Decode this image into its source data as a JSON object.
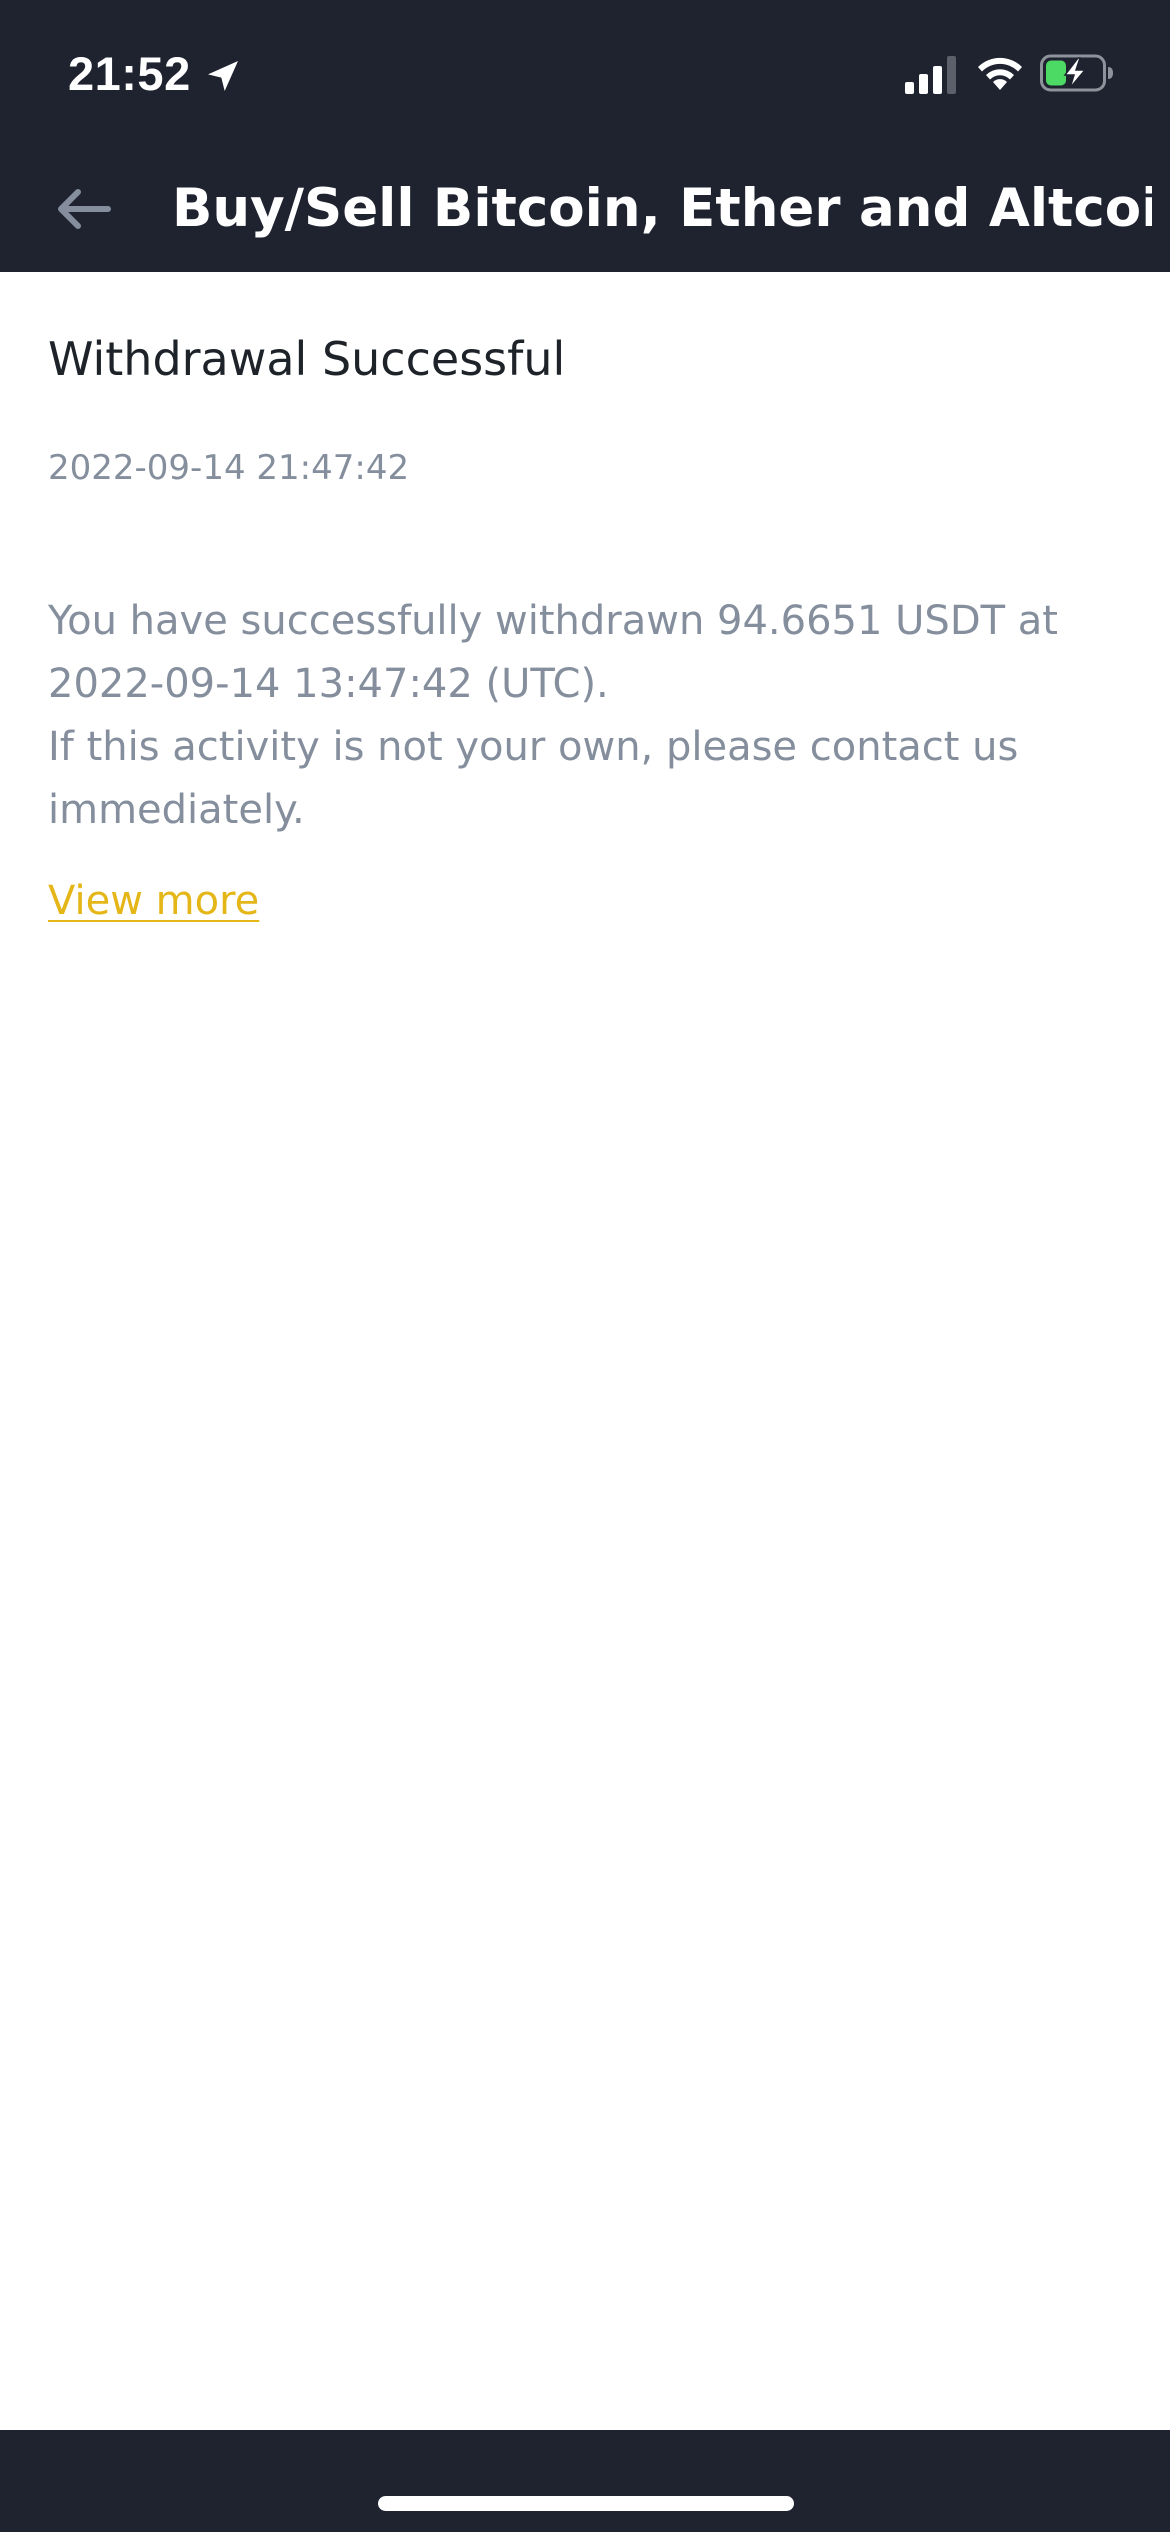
{
  "status_bar": {
    "time": "21:52",
    "icons": [
      "location-arrow-icon",
      "cellular-signal-icon",
      "wifi-icon",
      "battery-charging-icon"
    ]
  },
  "header": {
    "back_icon": "arrow-left-icon",
    "title": "Buy/Sell Bitcoin, Ether and Altcoins..."
  },
  "message": {
    "title": "Withdrawal Successful",
    "date": "2022-09-14 21:47:42",
    "body_line1": "You have successfully withdrawn 94.6651 USDT at 2022-09-14 13:47:42 (UTC).",
    "body_line2": "If this activity is not your own, please contact us immediately.",
    "view_more": "View more"
  },
  "colors": {
    "header_bg": "#1f2330",
    "title_text": "#1e2329",
    "muted_text": "#848e9c",
    "link": "#e5b618",
    "battery_green": "#4cd964"
  }
}
